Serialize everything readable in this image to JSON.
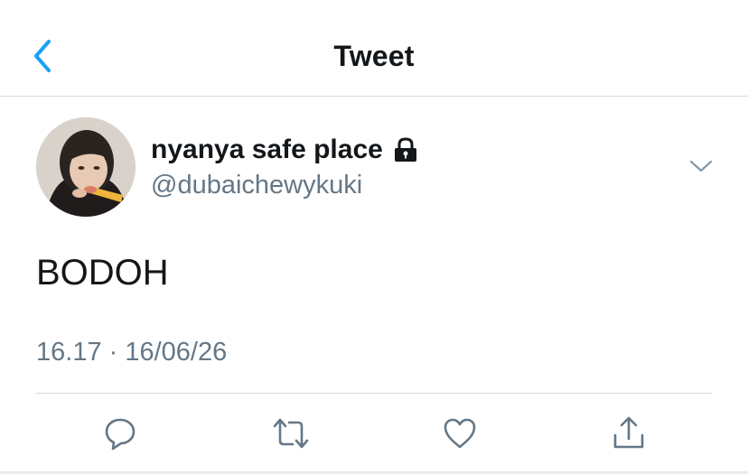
{
  "header": {
    "title": "Tweet"
  },
  "tweet": {
    "display_name": "nyanya safe place",
    "handle": "@dubaichewykuki",
    "text": "BODOH",
    "timestamp": "16.17 · 16/06/26"
  },
  "icons": {
    "back": "chevron-left-icon",
    "lock": "lock-icon",
    "menu": "chevron-down-icon",
    "reply": "reply-icon",
    "retweet": "retweet-icon",
    "like": "heart-icon",
    "share": "share-icon"
  },
  "colors": {
    "accent": "#1da1f2",
    "text": "#14171a",
    "secondary": "#657786",
    "divider": "#d6d9dc"
  }
}
